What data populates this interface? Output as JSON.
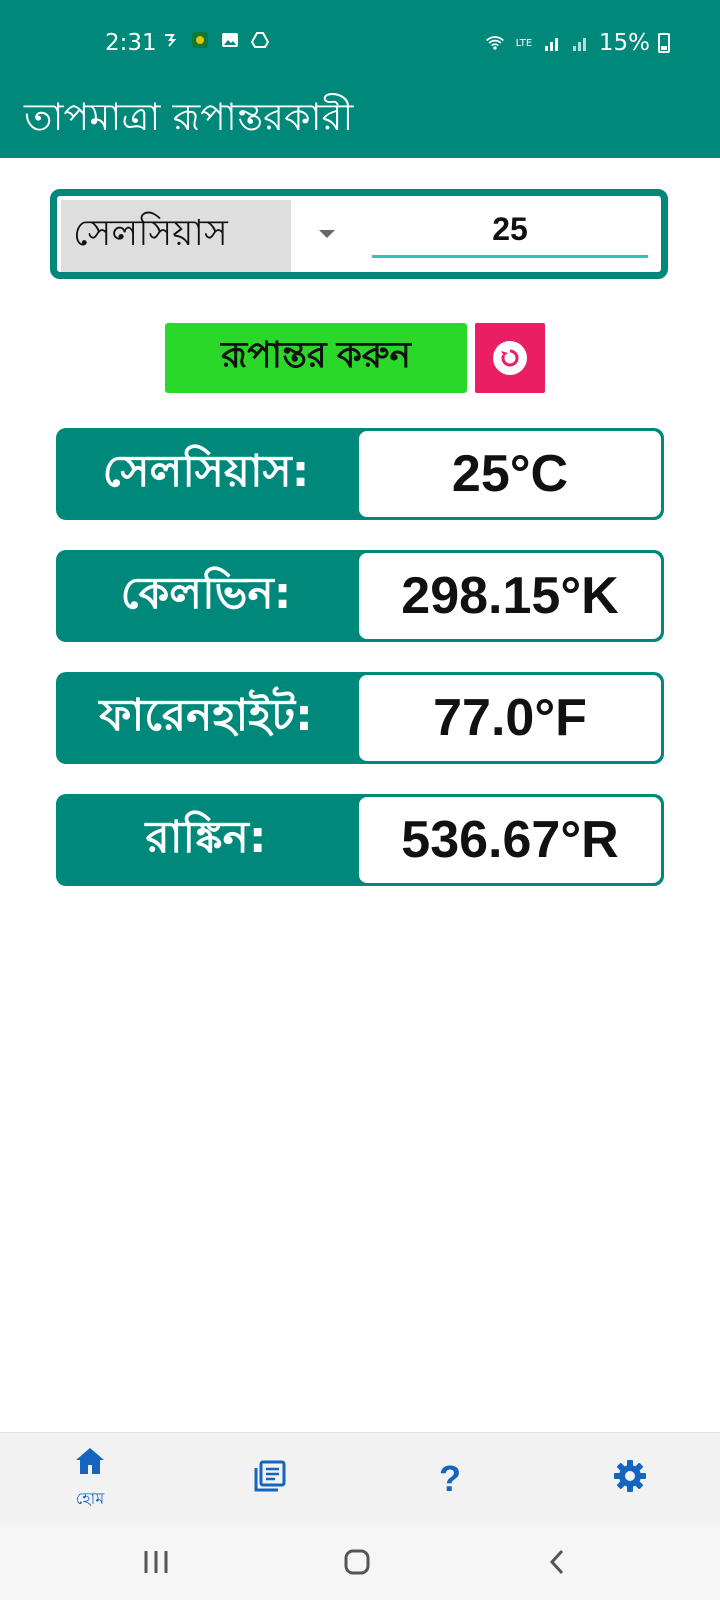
{
  "status": {
    "time": "2:31",
    "icons_left": [
      "sync-icon",
      "app-icon",
      "gallery-icon",
      "drive-icon"
    ],
    "icons_right": [
      "wifi-icon",
      "volte-icon",
      "signal-icon",
      "signal-icon"
    ],
    "battery_label": "15%"
  },
  "appbar": {
    "title": "তাপমাত্রা রূপান্তরকারী"
  },
  "input": {
    "selected_unit": "সেলসিয়াস",
    "value": "25"
  },
  "buttons": {
    "convert_label": "রূপান্তর করুন",
    "reset_icon": "reset-icon"
  },
  "results": [
    {
      "label": "সেলসিয়াস:",
      "value": "25°C"
    },
    {
      "label": "কেলভিন:",
      "value": "298.15°K"
    },
    {
      "label": "ফারেনহাইট:",
      "value": "77.0°F"
    },
    {
      "label": "রাঙ্কিন:",
      "value": "536.67°R"
    }
  ],
  "bottom_nav": {
    "items": [
      {
        "icon": "home-icon",
        "label": "হোম"
      },
      {
        "icon": "library-icon",
        "label": ""
      },
      {
        "icon": "help-icon",
        "label": ""
      },
      {
        "icon": "settings-icon",
        "label": ""
      }
    ]
  },
  "colors": {
    "primary": "#00897b",
    "convert": "#2ad82a",
    "reset": "#e91e63",
    "nav_accent": "#1565c0"
  }
}
